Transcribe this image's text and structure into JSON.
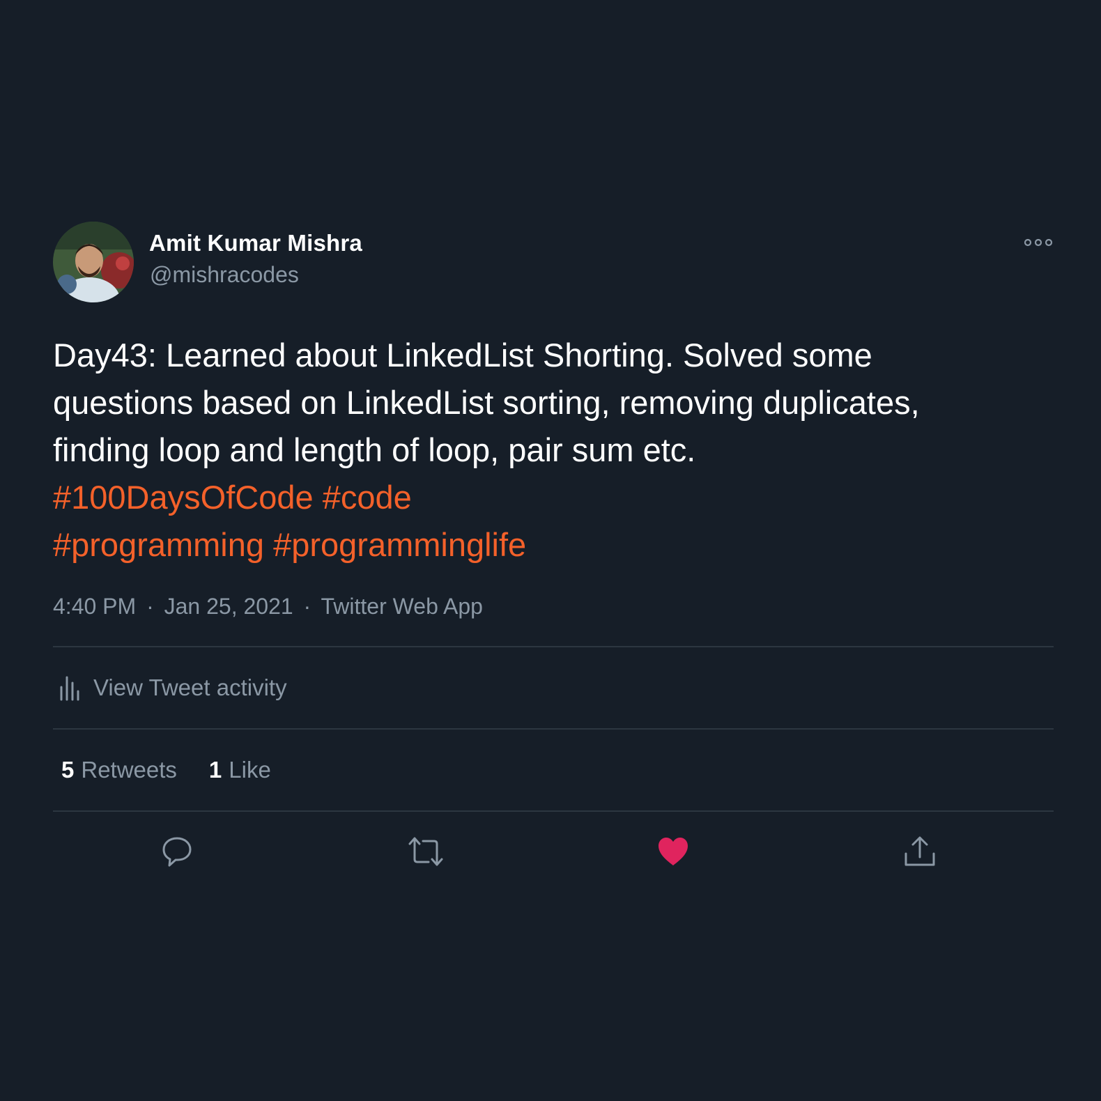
{
  "author": {
    "name": "Amit Kumar Mishra",
    "handle": "@mishracodes"
  },
  "tweet": {
    "text_lines": [
      "Day43: Learned about LinkedList Shorting. Solved some",
      "questions based on LinkedList sorting, removing duplicates,",
      "finding loop and length of loop, pair sum etc."
    ],
    "hashtags": [
      [
        "#100DaysOfCode",
        "#code"
      ],
      [
        "#programming",
        "#programminglife"
      ]
    ],
    "time": "4:40 PM",
    "date": "Jan 25, 2021",
    "source": "Twitter Web App",
    "separator": "·"
  },
  "activity": {
    "label": "View Tweet activity",
    "icon": "bar-chart-icon"
  },
  "stats": {
    "retweets_count": "5",
    "retweets_label": "Retweets",
    "likes_count": "1",
    "likes_label": "Like"
  },
  "actions": {
    "reply_icon": "comment-icon",
    "retweet_icon": "retweet-icon",
    "like_icon": "heart-icon",
    "share_icon": "share-icon",
    "like_color": "#e0245e"
  },
  "colors": {
    "background": "#161e28",
    "hashtag": "#f4612a",
    "secondary_text": "#8b98a5",
    "divider": "#2c3640"
  }
}
